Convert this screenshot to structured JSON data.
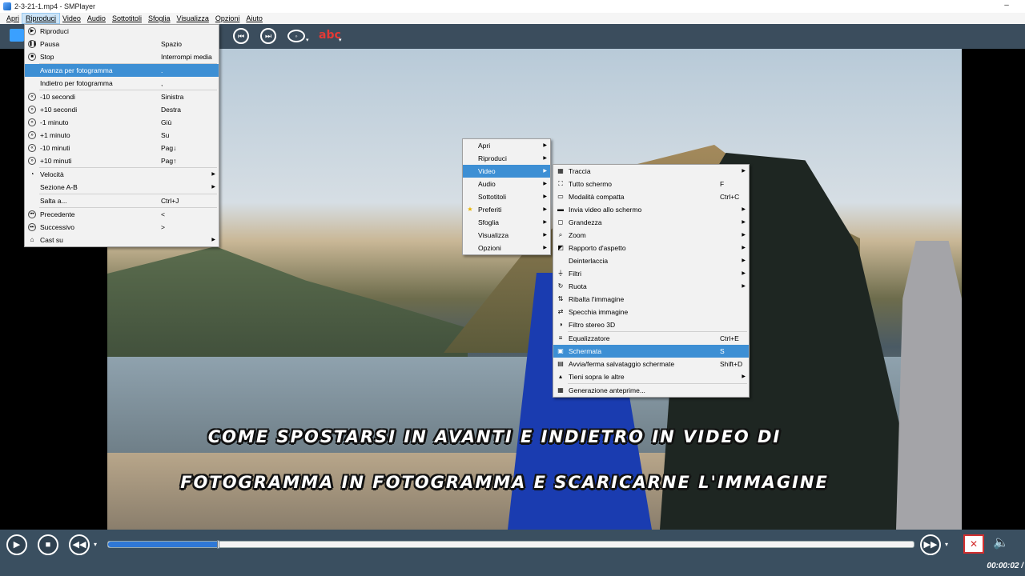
{
  "window": {
    "title": "2-3-21-1.mp4 - SMPlayer",
    "minimize_glyph": "–"
  },
  "menubar": {
    "items": [
      "Apri",
      "Riproduci",
      "Video",
      "Audio",
      "Sottotitoli",
      "Sfoglia",
      "Visualizza",
      "Opzioni",
      "Aiuto"
    ],
    "active": "Riproduci"
  },
  "play_menu": [
    {
      "label": "Riproduci",
      "shortcut": "",
      "icon": "play-icon"
    },
    {
      "label": "Pausa",
      "shortcut": "Spazio",
      "icon": "pause-icon"
    },
    {
      "label": "Stop",
      "shortcut": "Interrompi media",
      "icon": "stop-icon"
    },
    {
      "label": "Avanza per fotogramma",
      "shortcut": ".",
      "icon": "",
      "highlighted": true
    },
    {
      "label": "Indietro per fotogramma",
      "shortcut": ",",
      "icon": ""
    },
    {
      "label": "-10 secondi",
      "shortcut": "Sinistra",
      "icon": "rewind-icon"
    },
    {
      "label": "+10 secondi",
      "shortcut": "Destra",
      "icon": "forward-icon"
    },
    {
      "label": "-1 minuto",
      "shortcut": "Giù",
      "icon": "rewind-icon"
    },
    {
      "label": "+1 minuto",
      "shortcut": "Su",
      "icon": "forward-icon"
    },
    {
      "label": "-10 minuti",
      "shortcut": "Pag↓",
      "icon": "rewind-icon"
    },
    {
      "label": "+10 minuti",
      "shortcut": "Pag↑",
      "icon": "forward-icon"
    },
    {
      "label": "Velocità",
      "shortcut": "",
      "icon": "speed-icon",
      "submenu": true
    },
    {
      "label": "Sezione A-B",
      "shortcut": "",
      "icon": "",
      "submenu": true
    },
    {
      "label": "Salta a...",
      "shortcut": "Ctrl+J",
      "icon": ""
    },
    {
      "label": "Precedente",
      "shortcut": "<",
      "icon": "previous-icon"
    },
    {
      "label": "Successivo",
      "shortcut": ">",
      "icon": "next-icon"
    },
    {
      "label": "Cast su",
      "shortcut": "",
      "icon": "cast-icon",
      "submenu": true
    }
  ],
  "context_menu": [
    {
      "label": "Apri"
    },
    {
      "label": "Riproduci"
    },
    {
      "label": "Video",
      "highlighted": true
    },
    {
      "label": "Audio"
    },
    {
      "label": "Sottotitoli"
    },
    {
      "label": "Preferiti",
      "icon": "star-icon"
    },
    {
      "label": "Sfoglia"
    },
    {
      "label": "Visualizza"
    },
    {
      "label": "Opzioni"
    }
  ],
  "video_menu": [
    {
      "label": "Traccia",
      "shortcut": "",
      "icon": "film-icon",
      "submenu": true
    },
    {
      "label": "Tutto schermo",
      "shortcut": "F",
      "icon": "fullscreen-icon"
    },
    {
      "label": "Modalità compatta",
      "shortcut": "Ctrl+C",
      "icon": "compact-icon"
    },
    {
      "label": "Invia video allo schermo",
      "shortcut": "",
      "icon": "monitor-icon",
      "submenu": true
    },
    {
      "label": "Grandezza",
      "shortcut": "",
      "icon": "size-icon",
      "submenu": true
    },
    {
      "label": "Zoom",
      "shortcut": "",
      "icon": "zoom-icon",
      "submenu": true
    },
    {
      "label": "Rapporto d'aspetto",
      "shortcut": "",
      "icon": "aspect-icon",
      "submenu": true
    },
    {
      "label": "Deinterlaccia",
      "shortcut": "",
      "icon": "",
      "submenu": true
    },
    {
      "label": "Filtri",
      "shortcut": "",
      "icon": "filter-icon",
      "submenu": true
    },
    {
      "label": "Ruota",
      "shortcut": "",
      "icon": "rotate-icon",
      "submenu": true
    },
    {
      "label": "Ribalta l'immagine",
      "shortcut": "",
      "icon": "flip-icon"
    },
    {
      "label": "Specchia immagine",
      "shortcut": "",
      "icon": "mirror-icon"
    },
    {
      "label": "Filtro stereo 3D",
      "shortcut": "",
      "icon": "stereo-3d-icon"
    },
    {
      "label": "Equalizzatore",
      "shortcut": "Ctrl+E",
      "icon": "equalizer-icon"
    },
    {
      "label": "Schermata",
      "shortcut": "S",
      "icon": "screenshot-icon",
      "highlighted": true
    },
    {
      "label": "Avvia/ferma salvataggio schermate",
      "shortcut": "Shift+D",
      "icon": "screenshots-icon"
    },
    {
      "label": "Tieni sopra le altre",
      "shortcut": "",
      "icon": "on-top-icon",
      "submenu": true
    },
    {
      "label": "Generazione anteprime...",
      "shortcut": "",
      "icon": "preview-icon"
    }
  ],
  "caption": {
    "line1": "Come spostarsi in avanti e indietro in video di",
    "line2": "fotogramma in fotogramma e scaricarne l'immagine"
  },
  "player": {
    "time": "00:00:02 /",
    "progress": 0.135
  },
  "colors": {
    "highlight": "#3d8fd4",
    "toolbar": "#3b4d5d",
    "seek_fill": "#2f78d6"
  }
}
